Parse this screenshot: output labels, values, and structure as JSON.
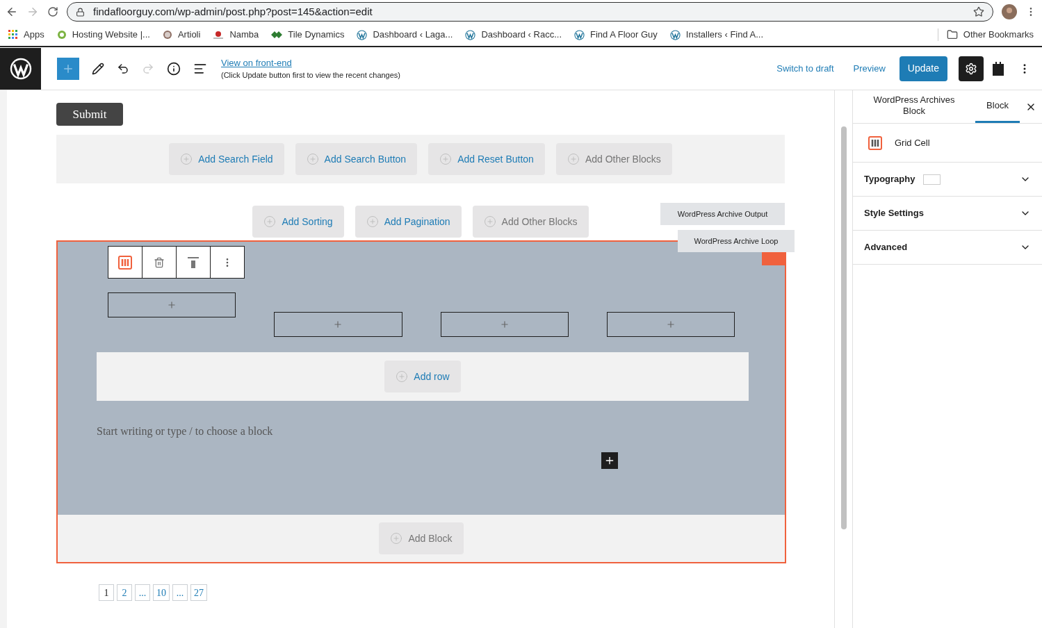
{
  "browser": {
    "url": "findafloorguy.com/wp-admin/post.php?post=145&action=edit",
    "bookmarks": [
      {
        "label": "Apps"
      },
      {
        "label": "Hosting Website |..."
      },
      {
        "label": "Artioli"
      },
      {
        "label": "Namba"
      },
      {
        "label": "Tile Dynamics"
      },
      {
        "label": "Dashboard ‹ Laga..."
      },
      {
        "label": "Dashboard ‹ Racc..."
      },
      {
        "label": "Find A Floor Guy"
      },
      {
        "label": "Installers ‹ Find A..."
      }
    ],
    "other_bookmarks": "Other Bookmarks"
  },
  "toolbar": {
    "link": "View on front-end",
    "note": "(Click Update button first to view the recent changes)",
    "switch_to_draft": "Switch to draft",
    "preview": "Preview",
    "update": "Update"
  },
  "editor": {
    "submit": "Submit",
    "search_buttons": [
      {
        "label": "Add Search Field",
        "muted": false
      },
      {
        "label": "Add Search Button",
        "muted": false
      },
      {
        "label": "Add Reset Button",
        "muted": false
      },
      {
        "label": "Add Other Blocks",
        "muted": true
      }
    ],
    "output_buttons": [
      {
        "label": "Add Sorting",
        "muted": false
      },
      {
        "label": "Add Pagination",
        "muted": false
      },
      {
        "label": "Add Other Blocks",
        "muted": true
      }
    ],
    "tooltips": [
      "WordPress Archive Output",
      "WordPress Archive Loop"
    ],
    "add_row": "Add row",
    "placeholder": "Start writing or type / to choose a block",
    "add_block": "Add Block",
    "pagination": [
      {
        "label": "1",
        "selected": true
      },
      {
        "label": "2",
        "selected": false
      },
      {
        "label": "...",
        "selected": false
      },
      {
        "label": "10",
        "selected": false
      },
      {
        "label": "...",
        "selected": false
      },
      {
        "label": "27",
        "selected": false
      }
    ]
  },
  "sidebar": {
    "tabs": [
      {
        "label": "WordPress Archives Block",
        "selected": false
      },
      {
        "label": "Block",
        "selected": true
      }
    ],
    "block_name": "Grid Cell",
    "panels": [
      {
        "label": "Typography",
        "kind": "swatch"
      },
      {
        "label": "Style Settings",
        "kind": "plain"
      },
      {
        "label": "Advanced",
        "kind": "plain"
      }
    ]
  }
}
